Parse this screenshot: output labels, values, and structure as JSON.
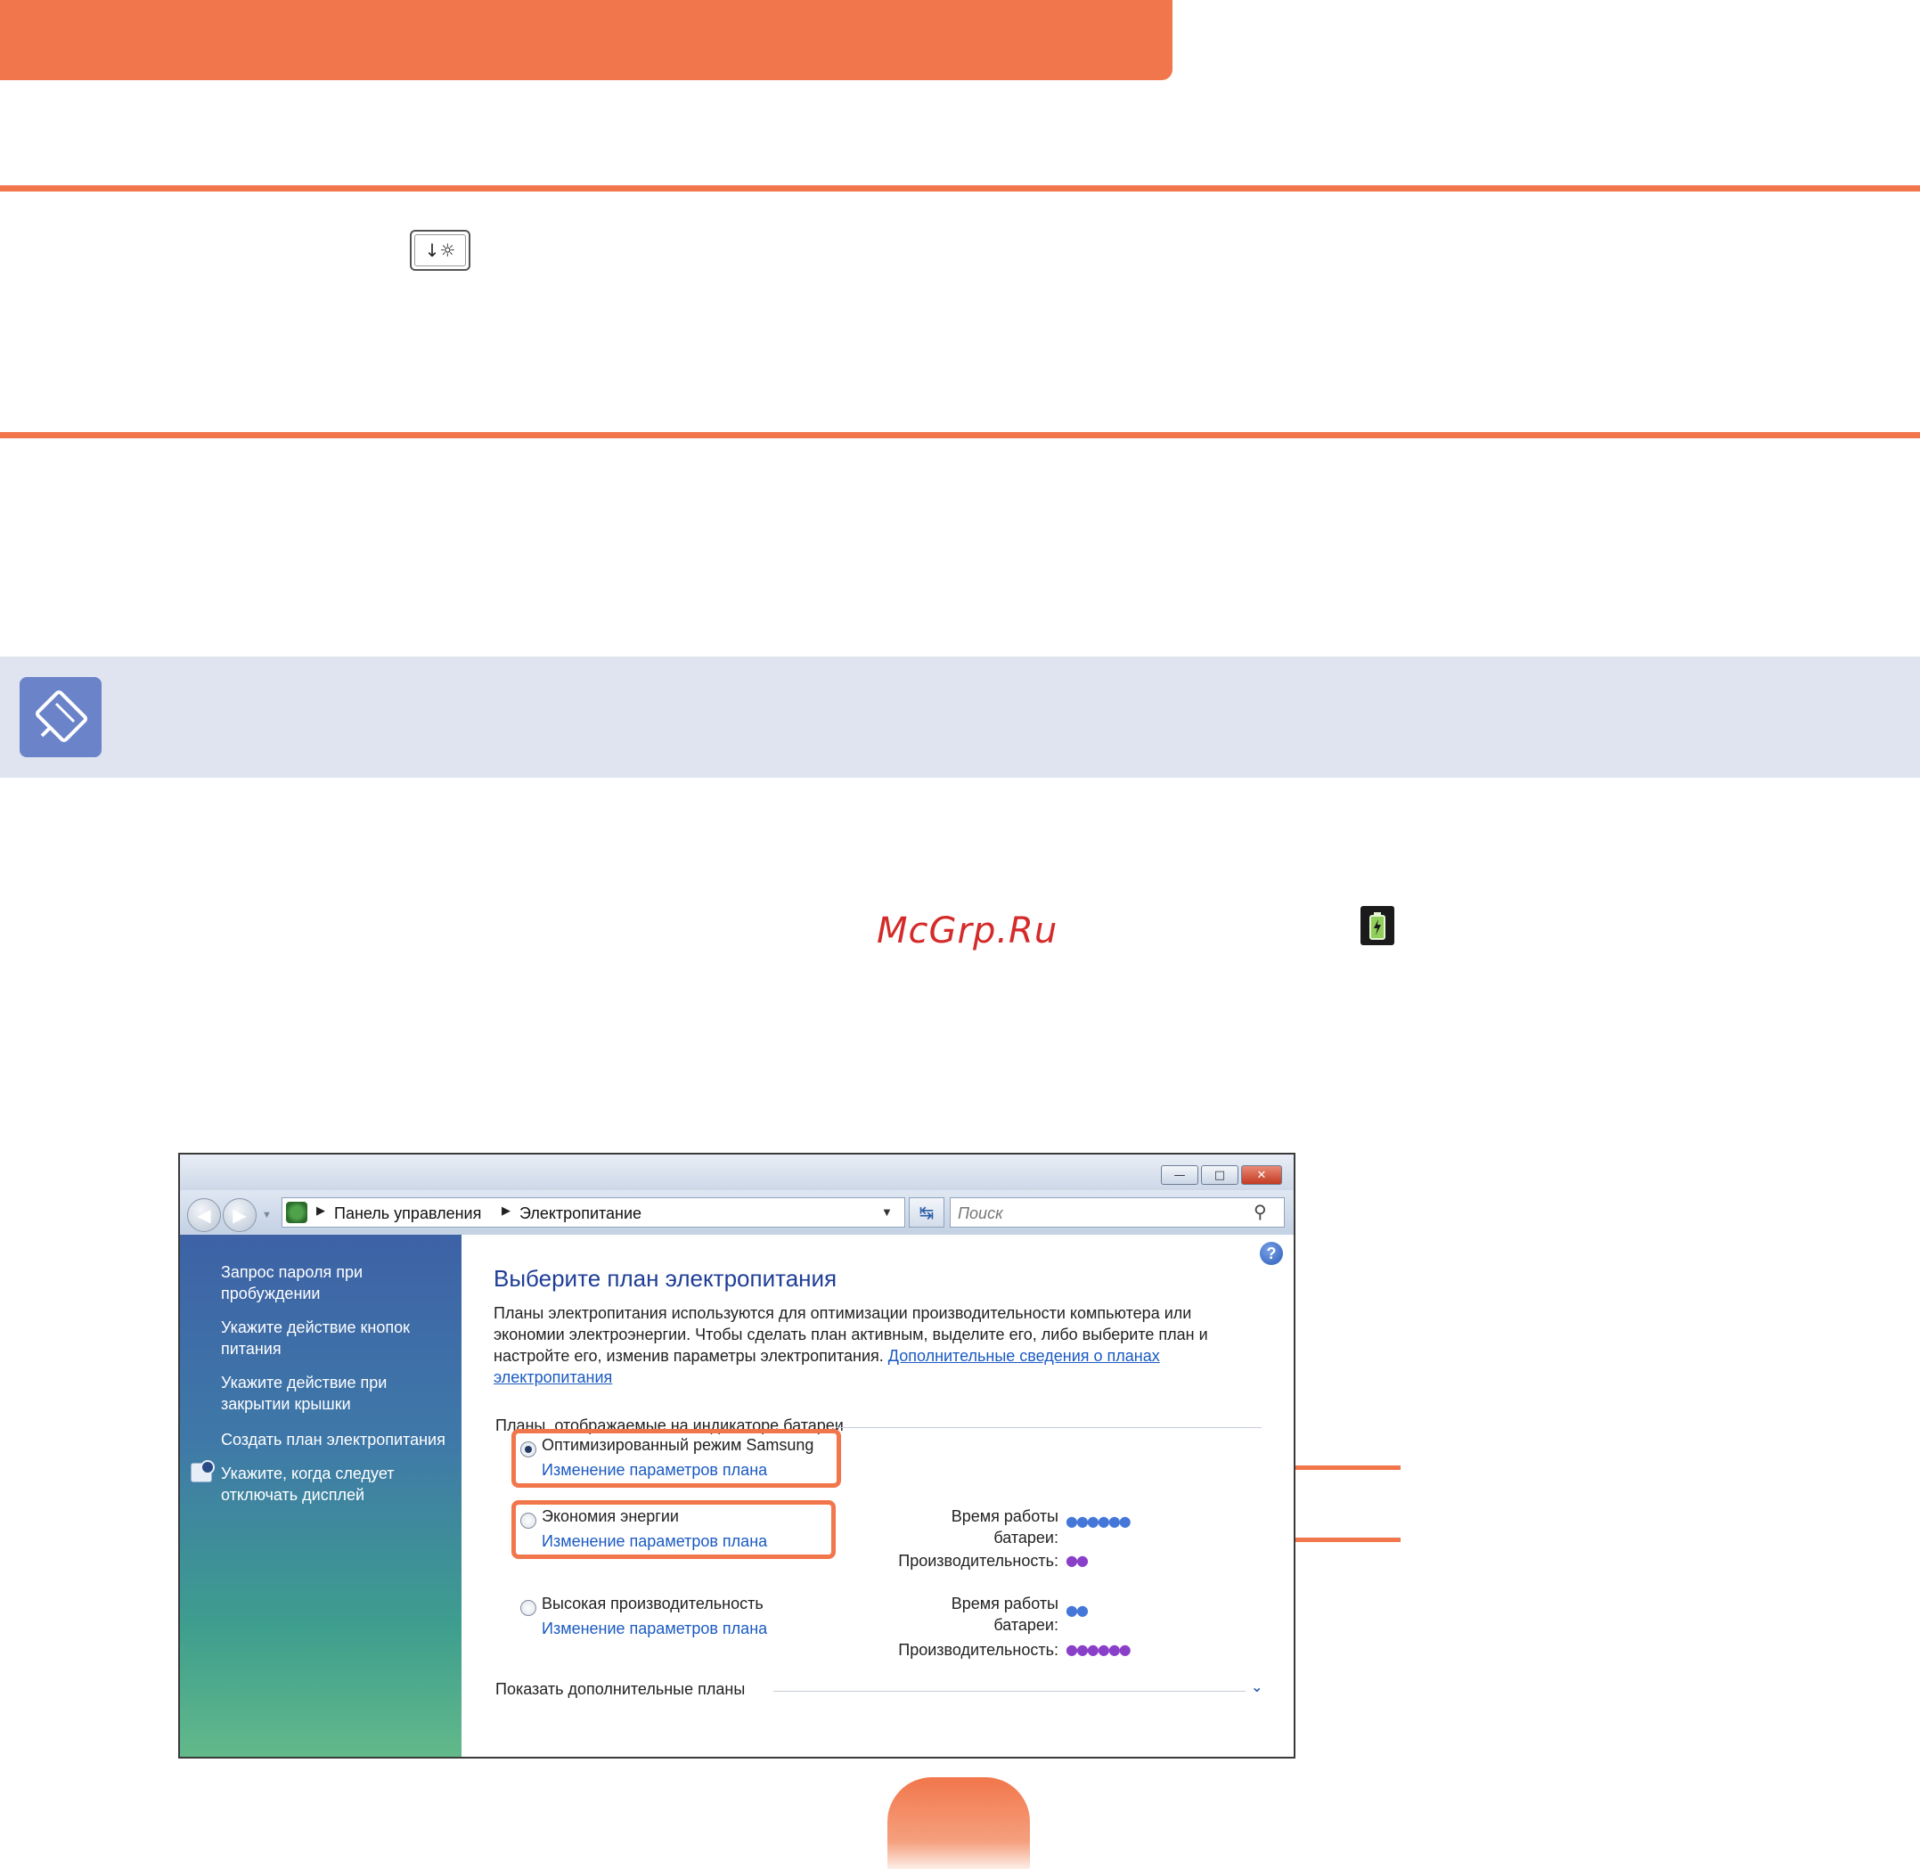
{
  "watermark": "McGrp.Ru",
  "window": {
    "buttons": {
      "minimize": "—",
      "maximize": "□",
      "close": "✕"
    },
    "breadcrumb": [
      "Панель управления",
      "Электропитание"
    ],
    "search_placeholder": "Поиск",
    "sidebar": {
      "links": [
        "Запрос пароля при пробуждении",
        "Укажите действие кнопок питания",
        "Укажите действие при закрытии крышки",
        "Создать план электропитания",
        "Укажите, когда следует отключать дисплей"
      ]
    },
    "content": {
      "title": "Выберите план электропитания",
      "description": "Планы электропитания используются для оптимизации производительности компьютера или экономии электроэнергии. Чтобы сделать план активным, выделите его, либо выберите план и настройте его, изменив параметры электропитания.",
      "description_link": "Дополнительные сведения о планах электропитания",
      "section_label": "Планы, отображаемые на индикаторе батареи",
      "plans": [
        {
          "name": "Оптимизированный режим Samsung",
          "link": "Изменение параметров плана",
          "selected": true
        },
        {
          "name": "Экономия энергии",
          "link": "Изменение параметров плана",
          "selected": false,
          "battery_label": "Время работы батареи:",
          "battery_level": 6,
          "performance_label": "Производительность:",
          "performance_level": 2
        },
        {
          "name": "Высокая производительность",
          "link": "Изменение параметров плана",
          "selected": false,
          "battery_label": "Время работы батареи:",
          "battery_level": 2,
          "performance_label": "Производительность:",
          "performance_level": 6
        }
      ],
      "more_plans_label": "Показать дополнительные планы"
    }
  },
  "colors": {
    "accent": "#f2764b",
    "note_band": "#e0e3f0",
    "link": "#1a5ac2",
    "title": "#1f3e96"
  },
  "icons": [
    "keyboard-key-icon",
    "note-pencil-icon",
    "battery-tray-icon",
    "help-icon",
    "search-icon",
    "refresh-icon"
  ]
}
